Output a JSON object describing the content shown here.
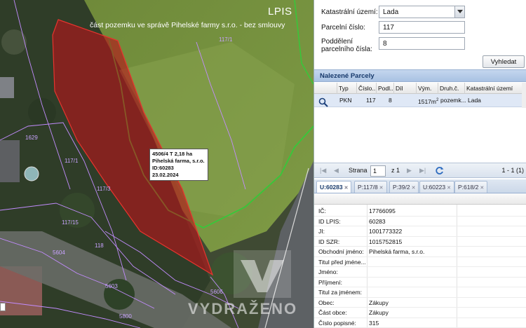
{
  "map": {
    "title": "LPIS",
    "subtitle": "část pozemku ve správě Pihelské farmy s.r.o. - bez smlouvy",
    "parcel_labels": [
      "117/1",
      "1629",
      "117/1",
      "117/3",
      "117/15",
      "5604",
      "118",
      "5800",
      "5606",
      "5603"
    ],
    "info_box": [
      "4506/4 T 2,18 ha",
      "Pihelská farma, s.r.o.",
      "ID:60283",
      "23.02.2024"
    ],
    "watermark": "VYDRAŽENO"
  },
  "form": {
    "kat_uzemi_label": "Katastrální území:",
    "kat_uzemi_value": "Lada",
    "parcelni_cislo_label": "Parcelní číslo:",
    "parcelni_cislo_value": "117",
    "podd_label_1": "Poddělení",
    "podd_label_2": "parcelního čísla:",
    "podd_value": "8",
    "search_button": "Vyhledat"
  },
  "results": {
    "title": "Nalezené Parcely",
    "columns": [
      "Typ",
      "Číslo...",
      "Podl...",
      "Díl",
      "Vým.",
      "Druh.č.",
      "Katastrální území"
    ],
    "row": {
      "typ": "PKN",
      "cislo": "117",
      "podl": "8",
      "dil": "",
      "vymera": "1517m",
      "vymera_sup": "2",
      "druh": "pozemk...",
      "kat": "Lada"
    }
  },
  "pager": {
    "page_label": "Strana",
    "page_value": "1",
    "of_label": "z 1",
    "range": "1 - 1 (1)"
  },
  "tabs": [
    {
      "label": "U:60283",
      "active": true
    },
    {
      "label": "P:117/8",
      "active": false
    },
    {
      "label": "P:39/2",
      "active": false
    },
    {
      "label": "U:60223",
      "active": false
    },
    {
      "label": "P:618/2",
      "active": false
    }
  ],
  "details": [
    {
      "label": "IČ:",
      "value": "17766095"
    },
    {
      "label": "ID LPIS:",
      "value": "60283"
    },
    {
      "label": "JI:",
      "value": "1001773322"
    },
    {
      "label": "ID SZR:",
      "value": "1015752815"
    },
    {
      "label": "Obchodní jméno:",
      "value": "Pihelská farma, s.r.o."
    },
    {
      "label": "Titul před jméne...",
      "value": ""
    },
    {
      "label": "Jméno:",
      "value": ""
    },
    {
      "label": "Příjmení:",
      "value": ""
    },
    {
      "label": "Titul za jménem:",
      "value": ""
    },
    {
      "label": "Obec:",
      "value": "Zákupy"
    },
    {
      "label": "Část obce:",
      "value": "Zákupy"
    },
    {
      "label": "Číslo popisné:",
      "value": "315"
    }
  ],
  "colors": {
    "parcel_fill": "#b8141a",
    "lpis_line": "#36c83a",
    "cadastre_line": "#c38cff",
    "accent": "#17396b"
  }
}
